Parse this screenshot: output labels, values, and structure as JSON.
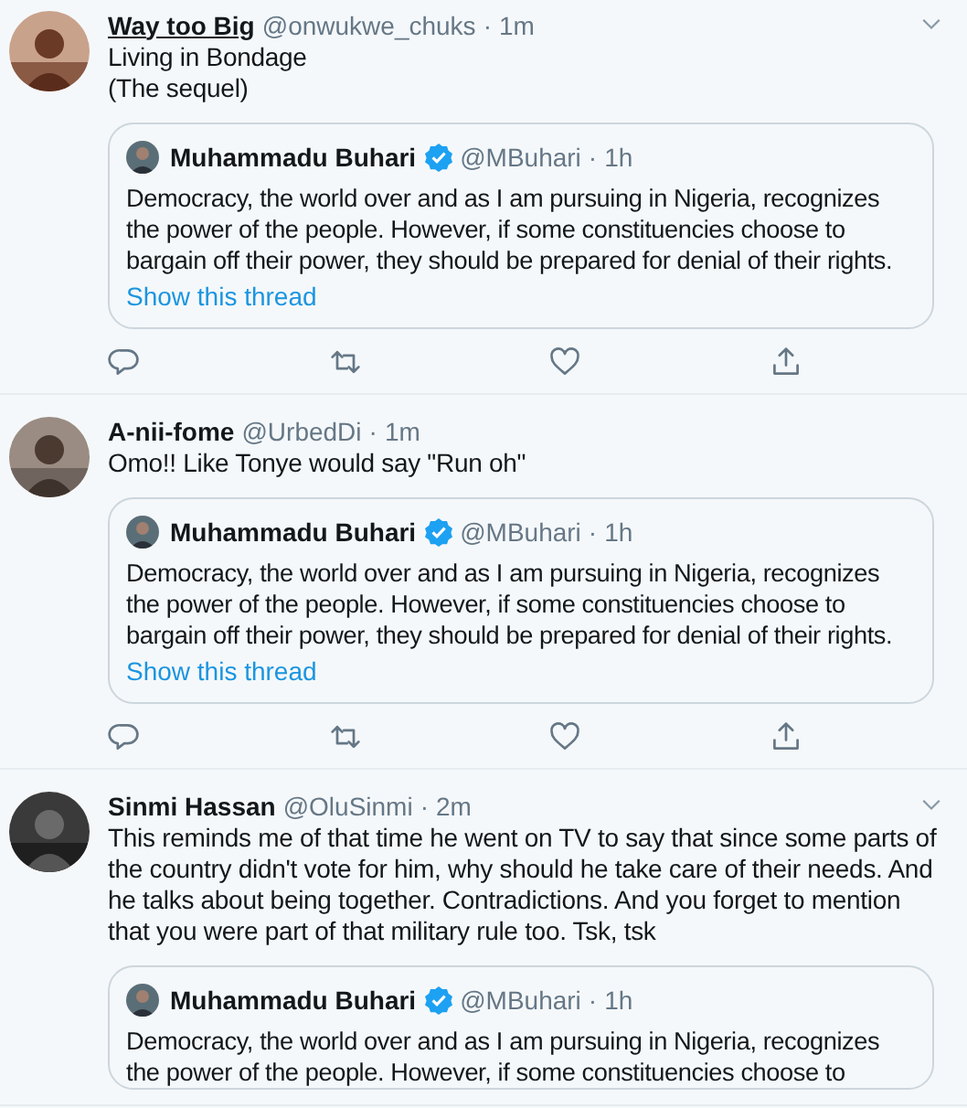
{
  "tweets": [
    {
      "name": "Way too Big",
      "name_underlined": true,
      "handle": "@onwukwe_chuks",
      "dot": "·",
      "time": "1m",
      "caret": true,
      "text": [
        "Living in Bondage",
        "(The sequel)"
      ],
      "quote": {
        "name": "Muhammadu Buhari",
        "verified": true,
        "handle": "@MBuhari",
        "dot": "·",
        "time": "1h",
        "text": "Democracy, the world over and as I am pursuing in Nigeria, recognizes the power of the people. However, if some constituencies choose to bargain off their power, they should be prepared for denial of their rights.",
        "thread_link": "Show this thread"
      }
    },
    {
      "name": "A-nii-fome",
      "name_underlined": false,
      "handle": "@UrbedDi",
      "dot": "·",
      "time": "1m",
      "caret": false,
      "text": [
        "Omo!! Like Tonye would say \"Run oh\""
      ],
      "quote": {
        "name": "Muhammadu Buhari",
        "verified": true,
        "handle": "@MBuhari",
        "dot": "·",
        "time": "1h",
        "text": "Democracy, the world over and as I am pursuing in Nigeria, recognizes the power of the people. However, if some constituencies choose to bargain off their power, they should be prepared for denial of their rights.",
        "thread_link": "Show this thread"
      }
    },
    {
      "name": "Sinmi Hassan",
      "name_underlined": false,
      "handle": "@OluSinmi",
      "dot": "·",
      "time": "2m",
      "caret": true,
      "text": [
        "This reminds me of that time he went on TV to say that since some parts of the country didn't vote for him, why should he take care of their needs. And he talks about being together. Contradictions. And you forget to mention that you were part of that military rule too. Tsk, tsk"
      ],
      "quote": {
        "name": "Muhammadu Buhari",
        "verified": true,
        "handle": "@MBuhari",
        "dot": "·",
        "time": "1h",
        "text": "Democracy, the world over and as I am pursuing in Nigeria, recognizes the power of the people. However, if some constituencies choose to"
      }
    }
  ]
}
